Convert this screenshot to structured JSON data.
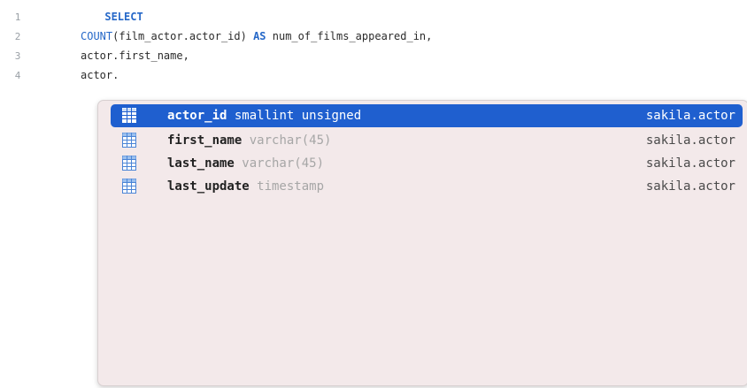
{
  "editor": {
    "lines": [
      {
        "number": "1",
        "parts": [
          {
            "text": "SELECT",
            "style": "kw"
          }
        ]
      },
      {
        "number": "2",
        "parts": [
          {
            "text": "COUNT",
            "style": "fn"
          },
          {
            "text": "(film_actor.actor_id) ",
            "style": "plain"
          },
          {
            "text": "AS",
            "style": "kw"
          },
          {
            "text": " num_of_films_appeared_in,",
            "style": "plain"
          }
        ]
      },
      {
        "number": "3",
        "parts": [
          {
            "text": "actor.first_name,",
            "style": "plain"
          }
        ]
      },
      {
        "number": "4",
        "parts": [
          {
            "text": "actor.",
            "style": "plain"
          }
        ]
      }
    ]
  },
  "autocomplete": {
    "items": [
      {
        "name": "actor_id",
        "type": " smallint unsigned",
        "source": "sakila.actor",
        "selected": true
      },
      {
        "name": "first_name",
        "type": " varchar(45)",
        "source": "sakila.actor",
        "selected": false
      },
      {
        "name": "last_name",
        "type": " varchar(45)",
        "source": "sakila.actor",
        "selected": false
      },
      {
        "name": "last_update",
        "type": " timestamp",
        "source": "sakila.actor",
        "selected": false
      }
    ],
    "icon": "table-column-icon"
  },
  "colors": {
    "keyword": "#2668c8",
    "selection": "#1f5fcf",
    "popup_background": "#f3e9ea"
  }
}
